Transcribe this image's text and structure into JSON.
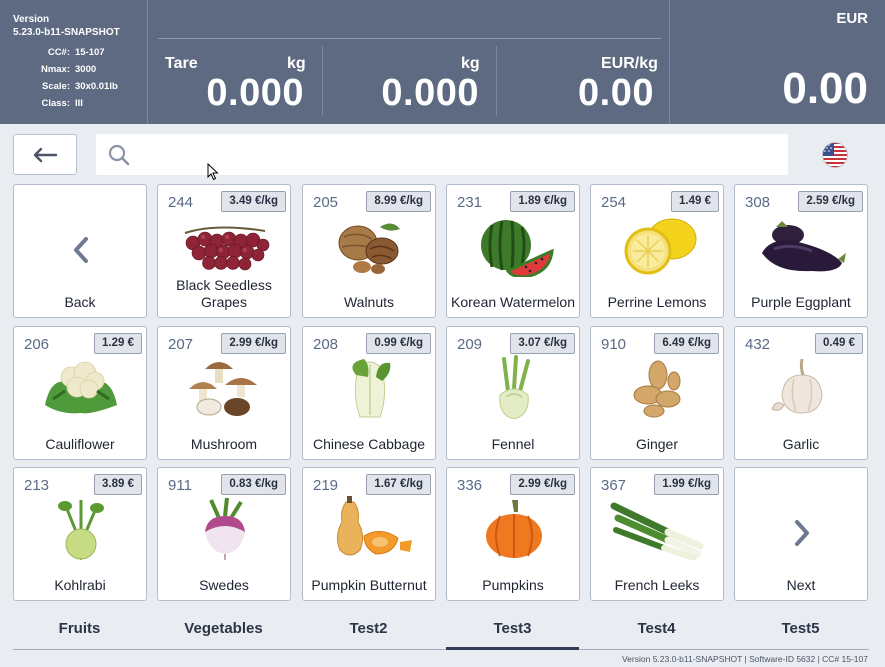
{
  "header": {
    "version_label": "Version",
    "version_value": "5.23.0-b11-SNAPSHOT",
    "info": [
      {
        "key": "CC#:",
        "value": "15-107"
      },
      {
        "key": "Nmax:",
        "value": "3000"
      },
      {
        "key": "Scale:",
        "value": "30x0.01lb"
      },
      {
        "key": "Class:",
        "value": "III"
      }
    ],
    "tare_label": "Tare",
    "tare_unit": "kg",
    "tare_value": "0.000",
    "weight_unit": "kg",
    "weight_value": "0.000",
    "unit_price_label": "EUR/kg",
    "unit_price_value": "0.00",
    "currency": "EUR",
    "total": "0.00"
  },
  "search": {
    "placeholder": "",
    "value": ""
  },
  "tiles": [
    {
      "type": "nav",
      "label": "Back",
      "icon": "chevron-left-icon"
    },
    {
      "plu": "244",
      "price": "3.49 €/kg",
      "name": "Black Seedless Grapes",
      "icon": "grapes-icon"
    },
    {
      "plu": "205",
      "price": "8.99 €/kg",
      "name": "Walnuts",
      "icon": "walnuts-icon"
    },
    {
      "plu": "231",
      "price": "1.89 €/kg",
      "name": "Korean Watermelon",
      "icon": "watermelon-icon"
    },
    {
      "plu": "254",
      "price": "1.49 €",
      "name": "Perrine Lemons",
      "icon": "lemon-icon"
    },
    {
      "plu": "308",
      "price": "2.59 €/kg",
      "name": "Purple Eggplant",
      "icon": "eggplant-icon"
    },
    {
      "plu": "206",
      "price": "1.29 €",
      "name": "Cauliflower",
      "icon": "cauliflower-icon"
    },
    {
      "plu": "207",
      "price": "2.99 €/kg",
      "name": "Mushroom",
      "icon": "mushroom-icon"
    },
    {
      "plu": "208",
      "price": "0.99 €/kg",
      "name": "Chinese Cabbage",
      "icon": "cabbage-icon"
    },
    {
      "plu": "209",
      "price": "3.07 €/kg",
      "name": "Fennel",
      "icon": "fennel-icon"
    },
    {
      "plu": "910",
      "price": "6.49 €/kg",
      "name": "Ginger",
      "icon": "ginger-icon"
    },
    {
      "plu": "432",
      "price": "0.49 €",
      "name": "Garlic",
      "icon": "garlic-icon"
    },
    {
      "plu": "213",
      "price": "3.89 €",
      "name": "Kohlrabi",
      "icon": "kohlrabi-icon"
    },
    {
      "plu": "911",
      "price": "0.83 €/kg",
      "name": "Swedes",
      "icon": "turnip-icon"
    },
    {
      "plu": "219",
      "price": "1.67 €/kg",
      "name": "Pumpkin Butternut",
      "icon": "butternut-icon"
    },
    {
      "plu": "336",
      "price": "2.99 €/kg",
      "name": "Pumpkins",
      "icon": "pumpkin-icon"
    },
    {
      "plu": "367",
      "price": "1.99 €/kg",
      "name": "French Leeks",
      "icon": "leek-icon"
    },
    {
      "type": "nav",
      "label": "Next",
      "icon": "chevron-right-icon"
    }
  ],
  "tabs": [
    "Fruits",
    "Vegetables",
    "Test2",
    "Test3",
    "Test4",
    "Test5"
  ],
  "active_tab": "Test3",
  "footer": "Version 5.23.0-b11-SNAPSHOT | Software-ID 5632 | CC# 15-107",
  "colors": {
    "header_bg": "#5d6a82",
    "page_bg": "#e9ecf1",
    "active_tab": "#2e3a57"
  }
}
